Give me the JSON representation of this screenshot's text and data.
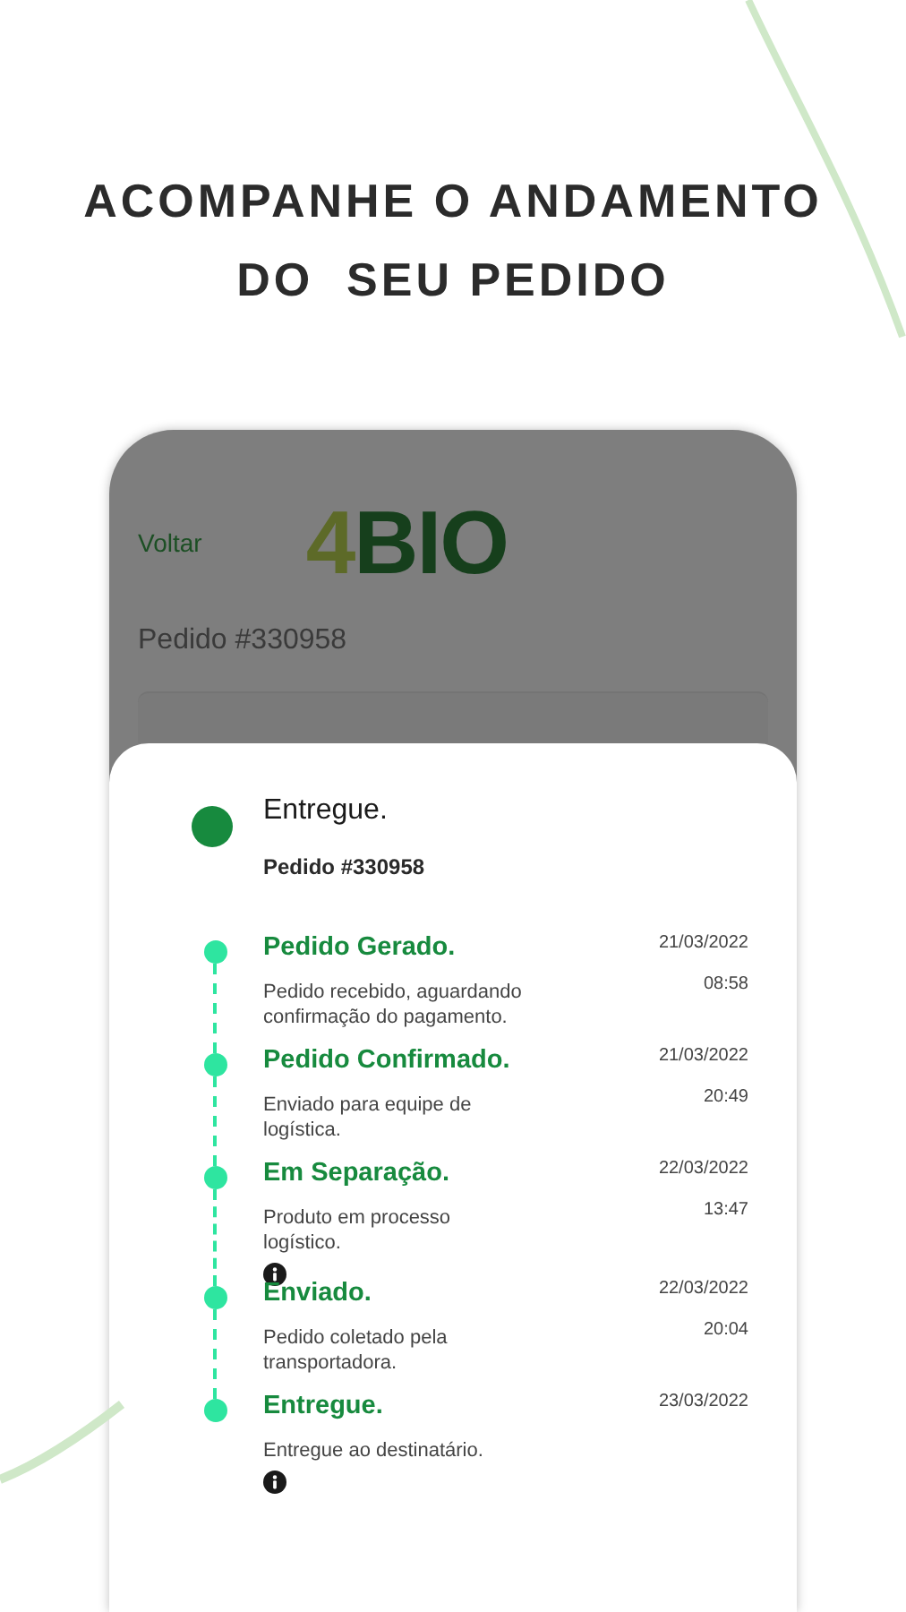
{
  "headline": [
    "ACOMPANHE O ANDAMENTO",
    "DO  SEU PEDIDO"
  ],
  "app_header": {
    "back_link": "Voltar",
    "logo": {
      "prefix": "4",
      "name": "BIO"
    },
    "order": "Pedido #330958"
  },
  "status_sheet": {
    "status": "Entregue.",
    "order": "Pedido #330958"
  },
  "timeline": [
    {
      "title": "Pedido Gerado.",
      "description": "Pedido recebido, aguardando confirmação do pagamento.",
      "date": "21/03/2022",
      "time": "08:58",
      "info": false
    },
    {
      "title": "Pedido Confirmado.",
      "description": "Enviado para equipe de logística.",
      "date": "21/03/2022",
      "time": "20:49",
      "info": false
    },
    {
      "title": "Em Separação.",
      "description": "Produto em processo logístico.",
      "date": "22/03/2022",
      "time": "13:47",
      "info": true
    },
    {
      "title": "Enviado.",
      "description": "Pedido coletado pela transportadora.",
      "date": "22/03/2022",
      "time": "20:04",
      "info": false
    },
    {
      "title": "Entregue.",
      "description": "Entregue ao destinatário.",
      "date": "23/03/2022",
      "info": true
    }
  ]
}
